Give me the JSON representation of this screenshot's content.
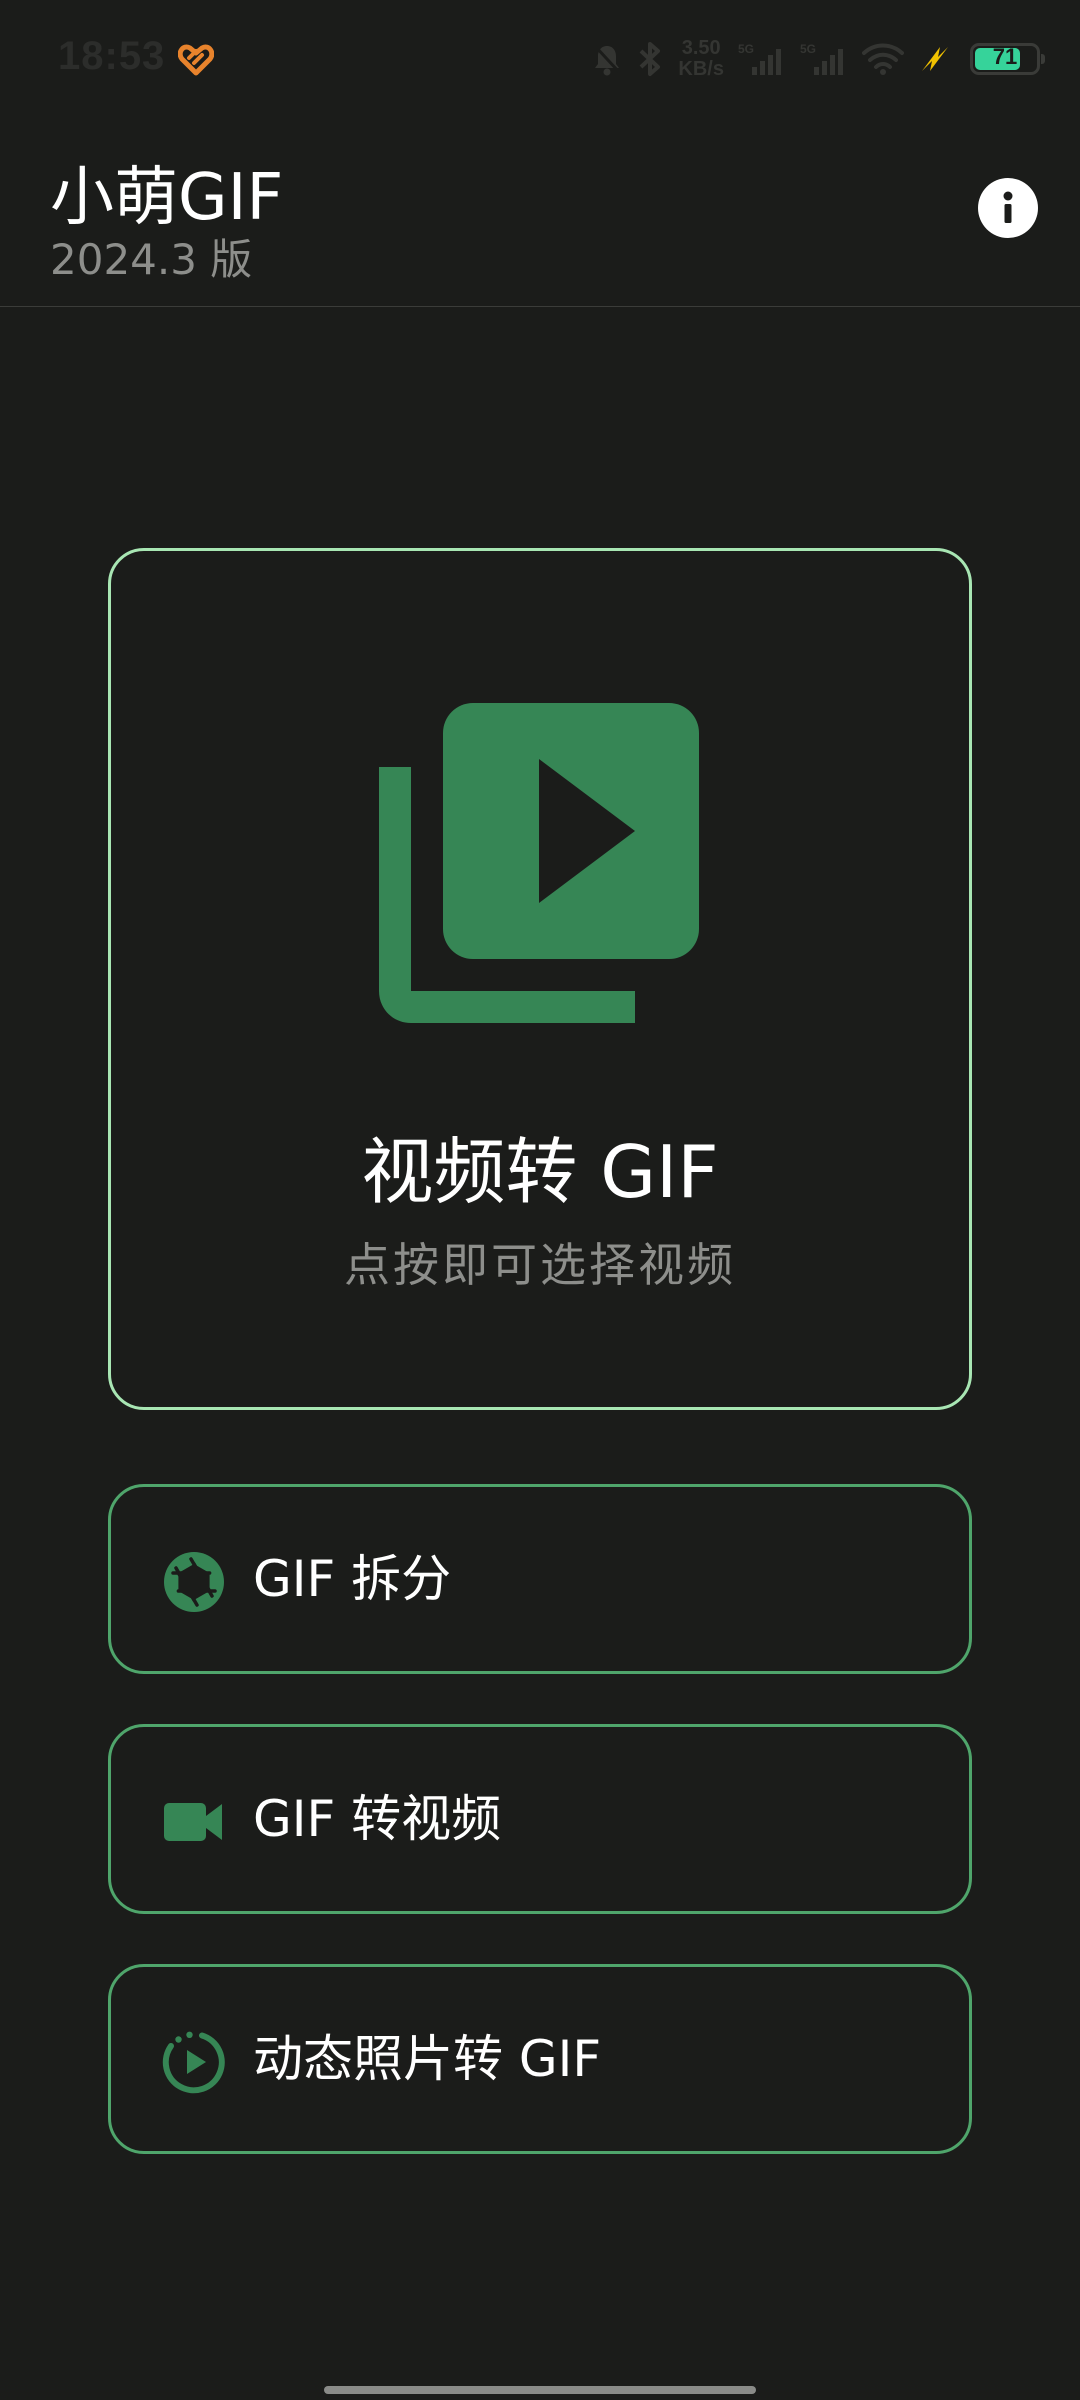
{
  "status_bar": {
    "time": "18:53",
    "net_speed_value": "3.50",
    "net_speed_unit": "KB/s",
    "signal_1_label": "5G",
    "signal_2_label": "5G",
    "battery_level": "71"
  },
  "header": {
    "title": "小萌GIF",
    "version": "2024.3 版"
  },
  "main_card": {
    "title": "视频转 GIF",
    "subtitle": "点按即可选择视频"
  },
  "options": [
    {
      "label": "GIF 拆分",
      "icon": "aperture-icon"
    },
    {
      "label": "GIF 转视频",
      "icon": "videocam-icon"
    },
    {
      "label": "动态照片转 GIF",
      "icon": "motion-photo-icon"
    }
  ],
  "colors": {
    "background": "#1b1c1a",
    "accent_green": "#368655",
    "card_border": "#a8e6b3",
    "option_border": "#4fa56b",
    "secondary_text": "#8d8e8b"
  }
}
